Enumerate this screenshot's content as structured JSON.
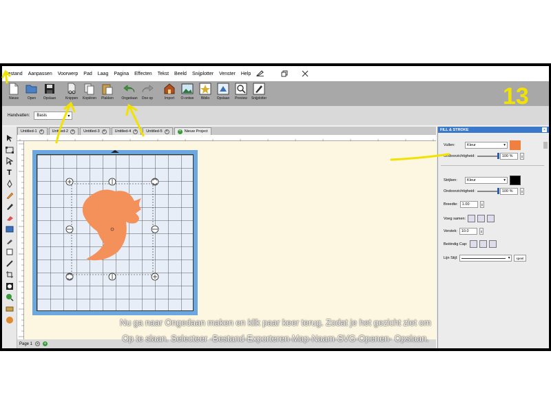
{
  "menubar": {
    "items": [
      "Bestand",
      "Aanpassen",
      "Voorwerp",
      "Pad",
      "Laag",
      "Pagina",
      "Effecten",
      "Tekst",
      "Beeld",
      "Snijplotter",
      "Venster",
      "Help"
    ],
    "window_controls": [
      "restore-icon",
      "close-icon"
    ]
  },
  "toolbar": {
    "buttons": [
      {
        "label": "Nieuw",
        "icon": "new-document-icon",
        "color": "#ffffff"
      },
      {
        "label": "Open",
        "icon": "open-folder-icon",
        "color": "#3c6fb4"
      },
      {
        "label": "Opslaan",
        "icon": "save-icon",
        "color": "#222222"
      },
      {
        "label": "Knippen",
        "icon": "cut-icon",
        "color": "#777777"
      },
      {
        "label": "Kopiëren",
        "icon": "copy-icon",
        "color": "#777777"
      },
      {
        "label": "Plakken",
        "icon": "paste-icon",
        "color": "#c8a050"
      },
      {
        "label": "Ongedaan",
        "icon": "undo-icon",
        "color": "#3a9a3a"
      },
      {
        "label": "Doe op",
        "icon": "redo-icon",
        "color": "#888888"
      },
      {
        "label": "Import",
        "icon": "import-icon",
        "color": "#b05020"
      },
      {
        "label": "O-ontwe",
        "icon": "image-icon",
        "color": "#2a7a3a"
      },
      {
        "label": "Biblio",
        "icon": "library-icon",
        "color": "#d8b030"
      },
      {
        "label": "Opslaan",
        "icon": "export-icon",
        "color": "#3a70c0"
      },
      {
        "label": "Preview",
        "icon": "preview-icon",
        "color": "#444444"
      },
      {
        "label": "Snijplotter",
        "icon": "cutter-icon",
        "color": "#333333"
      }
    ]
  },
  "subbar": {
    "handles_label": "Handvatten:",
    "handles_value": "Basis"
  },
  "tabs": [
    {
      "label": "Untitled-1"
    },
    {
      "label": "Untitled-2"
    },
    {
      "label": "Untitled-3"
    },
    {
      "label": "Untitled-4"
    },
    {
      "label": "Untitled-5"
    }
  ],
  "new_project_label": "Nieuw Project",
  "bottombar": {
    "page_label": "Page 1"
  },
  "panel": {
    "title": "FILL & STROKE",
    "fill_label": "Vullen:",
    "fill_mode": "Kleur",
    "fill_color": "#f08040",
    "fill_opacity_label": "Ondoorzichtigheid:",
    "fill_opacity": "100 %",
    "stroke_label": "Strijken:",
    "stroke_mode": "Kleur",
    "stroke_color": "#000000",
    "stroke_opacity_label": "Ondoorzichtigheid:",
    "stroke_opacity": "100 %",
    "width_label": "Breedte:",
    "width_value": "1.00",
    "join_label": "Voeg samen:",
    "miter_label": "Verstek:",
    "miter_value": "10.0",
    "cap_label": "Beëindig Cap:",
    "line_style_label": "Lijn Stijl:",
    "line_style_button": "speel"
  },
  "overlay": {
    "step_number": "13",
    "subtitle_line1": "Nu ga naar Ongedaan maken en klik paar keer terug. Zodat je het gezicht ziet om",
    "subtitle_line2": "Op te slaan. Selecteer -Bestand-Exporteren-Map-Naam-SVG-Openen- Opslaan.",
    "annotation_color": "#f2e200"
  },
  "shape": {
    "fill": "#f4915a"
  }
}
